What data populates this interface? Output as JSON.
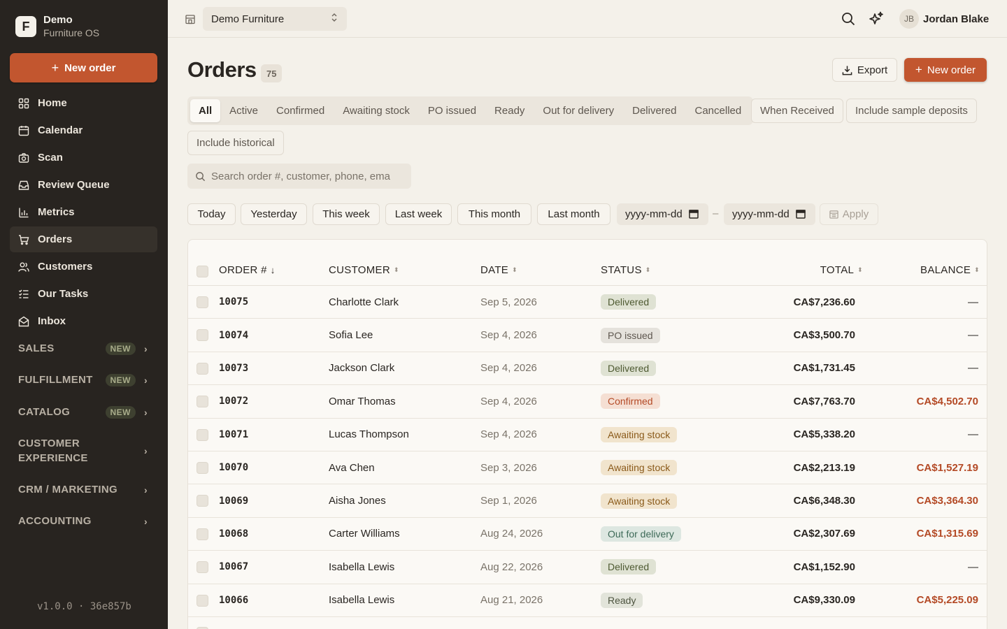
{
  "brand": {
    "logo_letter": "F",
    "name": "Demo",
    "subtitle": "Furniture OS"
  },
  "sidebar": {
    "new_order_label": "New order",
    "items": [
      {
        "label": "Home",
        "icon": "home-grid-icon"
      },
      {
        "label": "Calendar",
        "icon": "calendar-icon"
      },
      {
        "label": "Scan",
        "icon": "camera-icon"
      },
      {
        "label": "Review Queue",
        "icon": "inbox-tray-icon"
      },
      {
        "label": "Metrics",
        "icon": "bar-chart-icon"
      },
      {
        "label": "Orders",
        "icon": "cart-icon",
        "active": true
      },
      {
        "label": "Customers",
        "icon": "users-icon"
      },
      {
        "label": "Our Tasks",
        "icon": "task-list-icon"
      },
      {
        "label": "Inbox",
        "icon": "mail-icon"
      }
    ],
    "sections": [
      {
        "label": "SALES",
        "badge": "NEW"
      },
      {
        "label": "FULFILLMENT",
        "badge": "NEW"
      },
      {
        "label": "CATALOG",
        "badge": "NEW"
      },
      {
        "label": "CUSTOMER EXPERIENCE",
        "badge": ""
      },
      {
        "label": "CRM / MARKETING",
        "badge": ""
      },
      {
        "label": "ACCOUNTING",
        "badge": ""
      }
    ],
    "version": "v1.0.0 · 36e857b"
  },
  "topbar": {
    "store": "Demo Furniture",
    "user_initials": "JB",
    "user_name": "Jordan Blake"
  },
  "page": {
    "title": "Orders",
    "count": "75",
    "export_label": "Export",
    "new_order_label": "New order"
  },
  "filters": {
    "tabs": [
      "All",
      "Active",
      "Confirmed",
      "Awaiting stock",
      "PO issued",
      "Ready",
      "Out for delivery",
      "Delivered",
      "Cancelled"
    ],
    "active_tab": "All",
    "toggles": [
      "When Received",
      "Include sample deposits",
      "Include historical"
    ],
    "search_placeholder": "Search order #, customer, phone, ema",
    "ranges": [
      "Today",
      "Yesterday",
      "This week",
      "Last week",
      "This month",
      "Last month"
    ],
    "date_from_placeholder": "yyyy-mm-dd",
    "date_to_placeholder": "yyyy-mm-dd",
    "date_separator": "–",
    "apply_label": "Apply"
  },
  "table": {
    "headers": {
      "order": "ORDER #",
      "customer": "CUSTOMER",
      "date": "DATE",
      "status": "STATUS",
      "total": "TOTAL",
      "balance": "BALANCE"
    },
    "rows": [
      {
        "order": "10075",
        "customer": "Charlotte Clark",
        "date": "Sep 5, 2026",
        "status": "Delivered",
        "status_kind": "delivered",
        "total": "CA$7,236.60",
        "balance": "—"
      },
      {
        "order": "10074",
        "customer": "Sofia Lee",
        "date": "Sep 4, 2026",
        "status": "PO issued",
        "status_kind": "po",
        "total": "CA$3,500.70",
        "balance": "—"
      },
      {
        "order": "10073",
        "customer": "Jackson Clark",
        "date": "Sep 4, 2026",
        "status": "Delivered",
        "status_kind": "delivered",
        "total": "CA$1,731.45",
        "balance": "—"
      },
      {
        "order": "10072",
        "customer": "Omar Thomas",
        "date": "Sep 4, 2026",
        "status": "Confirmed",
        "status_kind": "confirmed",
        "total": "CA$7,763.70",
        "balance": "CA$4,502.70"
      },
      {
        "order": "10071",
        "customer": "Lucas Thompson",
        "date": "Sep 4, 2026",
        "status": "Awaiting stock",
        "status_kind": "awaiting",
        "total": "CA$5,338.20",
        "balance": "—"
      },
      {
        "order": "10070",
        "customer": "Ava Chen",
        "date": "Sep 3, 2026",
        "status": "Awaiting stock",
        "status_kind": "awaiting",
        "total": "CA$2,213.19",
        "balance": "CA$1,527.19"
      },
      {
        "order": "10069",
        "customer": "Aisha Jones",
        "date": "Sep 1, 2026",
        "status": "Awaiting stock",
        "status_kind": "awaiting",
        "total": "CA$6,348.30",
        "balance": "CA$3,364.30"
      },
      {
        "order": "10068",
        "customer": "Carter Williams",
        "date": "Aug 24, 2026",
        "status": "Out for delivery",
        "status_kind": "out",
        "total": "CA$2,307.69",
        "balance": "CA$1,315.69"
      },
      {
        "order": "10067",
        "customer": "Isabella Lewis",
        "date": "Aug 22, 2026",
        "status": "Delivered",
        "status_kind": "delivered",
        "total": "CA$1,152.90",
        "balance": "—"
      },
      {
        "order": "10066",
        "customer": "Isabella Lewis",
        "date": "Aug 21, 2026",
        "status": "Ready",
        "status_kind": "ready",
        "total": "CA$9,330.09",
        "balance": "CA$5,225.09"
      }
    ]
  },
  "colors": {
    "accent": "#c2562f",
    "sidebar_bg": "#282420",
    "page_bg": "#f4f1ea",
    "balance_due": "#b44a26"
  }
}
